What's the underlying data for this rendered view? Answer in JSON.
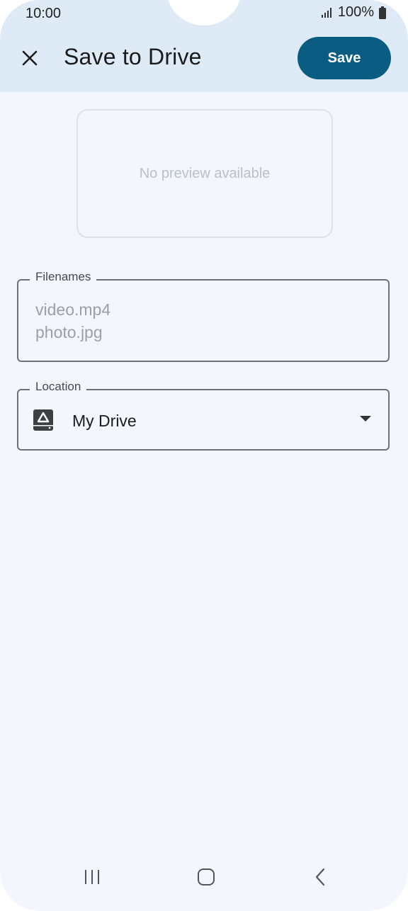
{
  "status_bar": {
    "time": "10:00",
    "battery": "100%"
  },
  "app_bar": {
    "title": "Save to Drive",
    "save_label": "Save",
    "close_icon": "close-icon"
  },
  "preview": {
    "text": "No preview available"
  },
  "filenames": {
    "label": "Filenames",
    "items": [
      "video.mp4",
      "photo.jpg"
    ]
  },
  "location": {
    "label": "Location",
    "value": "My Drive",
    "icon": "drive-icon"
  },
  "colors": {
    "accent": "#0a5c83",
    "app_bar_bg": "#deebf6",
    "page_bg": "#f3f7fd"
  }
}
